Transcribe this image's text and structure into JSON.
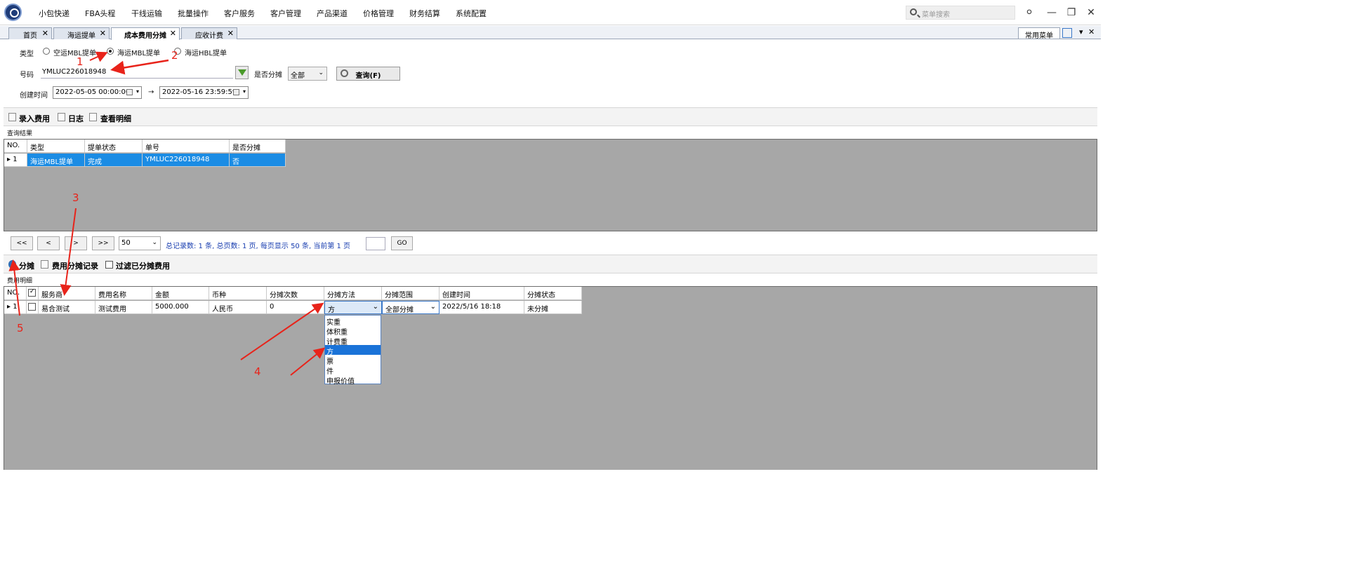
{
  "menubar": {
    "items": [
      "小包快递",
      "FBA头程",
      "干线运输",
      "批量操作",
      "客户服务",
      "客户管理",
      "产品渠道",
      "价格管理",
      "财务结算",
      "系统配置"
    ],
    "search_placeholder": "菜单搜索"
  },
  "tabs": [
    {
      "label": "首页"
    },
    {
      "label": "海运提单"
    },
    {
      "label": "成本费用分摊"
    },
    {
      "label": "应收计费"
    }
  ],
  "tabstrip": {
    "quick_menu": "常用菜单"
  },
  "query": {
    "type_label": "类型",
    "type_options": [
      "空运MBL提单",
      "海运MBL提单",
      "海运HBL提单"
    ],
    "selected_type": "海运MBL提单",
    "number_label": "号码",
    "number_value": "YMLUC226018948",
    "split_label": "是否分摊",
    "split_value": "全部",
    "query_button": "查询(F)",
    "created_label": "创建时间",
    "date_from": "2022-05-05 00:00:00",
    "date_to": "2022-05-16 23:59:59",
    "arrow": "→"
  },
  "toolbar1": {
    "enter_fee": "录入费用",
    "log": "日志",
    "view_detail": "查看明细"
  },
  "results": {
    "section_label": "查询结果",
    "headers": [
      "NO.",
      "类型",
      "提单状态",
      "单号",
      "是否分摊"
    ],
    "rows": [
      [
        "1",
        "海运MBL提单",
        "完成",
        "YMLUC226018948",
        "否"
      ]
    ]
  },
  "pager": {
    "first": "<<",
    "prev": "<",
    "next": ">",
    "last": ">>",
    "page_size": "50",
    "info": "总记录数: 1 条, 总页数: 1 页, 每页显示 50 条, 当前第 1 页",
    "go": "GO"
  },
  "toolbar2": {
    "split": "分摊",
    "split_records": "费用分摊记录",
    "filter_split": "过滤已分摊费用"
  },
  "details": {
    "section_label": "费用明细",
    "headers": [
      "NO.",
      "",
      "服务商",
      "费用名称",
      "金额",
      "币种",
      "分摊次数",
      "分摊方法",
      "分摊范围",
      "创建时间",
      "分摊状态"
    ],
    "row": {
      "no": "1",
      "provider": "易合测试",
      "fee_name": "测试费用",
      "amount": "5000.000",
      "currency": "人民币",
      "split_count": "0",
      "method": "方",
      "scope": "全部分摊",
      "created": "2022/5/16 18:18",
      "status": "未分摊"
    }
  },
  "method_dropdown": {
    "options": [
      "实重",
      "体积重",
      "计费重",
      "方",
      "票",
      "件",
      "申报价值"
    ],
    "selected": "方"
  },
  "annotations": [
    "1",
    "2",
    "3",
    "4",
    "5"
  ],
  "colors": {
    "accent": "#1b8ce4",
    "annotation": "#e8231a",
    "grid_bg": "#a7a7a7"
  }
}
